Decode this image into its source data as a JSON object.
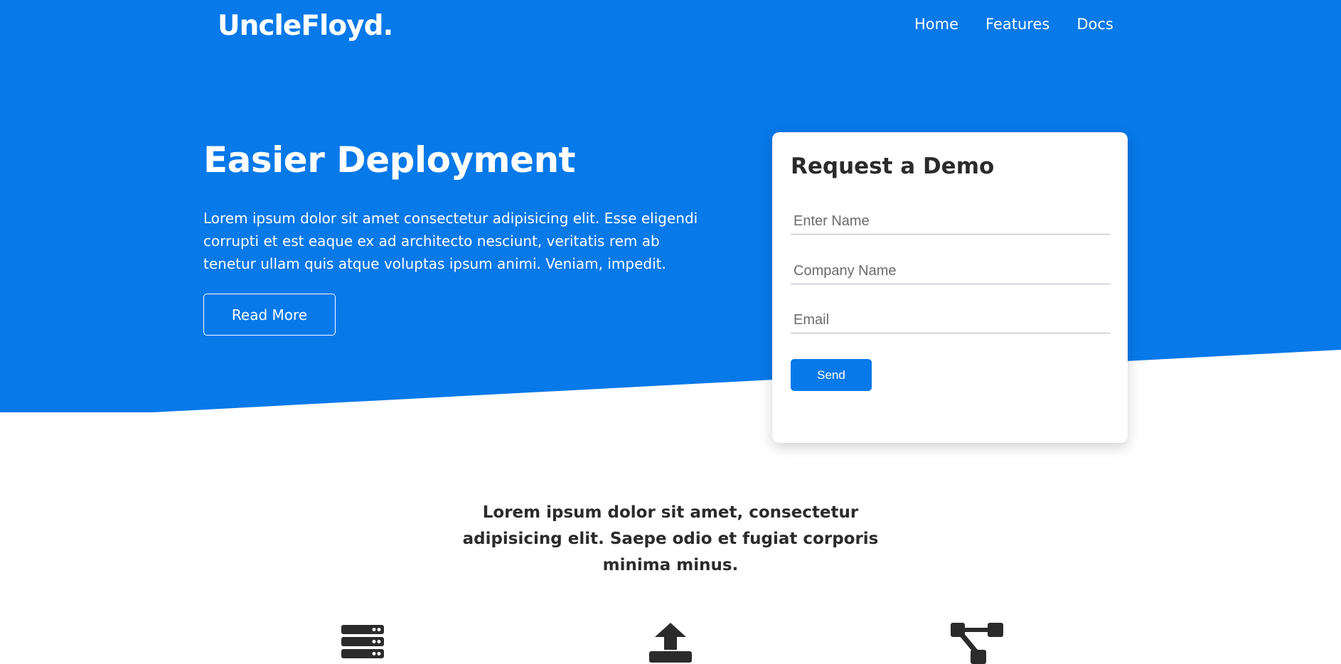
{
  "brand": {
    "logo": "UncleFloyd."
  },
  "nav": {
    "items": [
      {
        "label": "Home"
      },
      {
        "label": "Features"
      },
      {
        "label": "Docs"
      }
    ]
  },
  "hero": {
    "title": "Easier Deployment",
    "text": "Lorem ipsum dolor sit amet consectetur adipisicing elit. Esse eligendi corrupti et est eaque ex ad architecto nesciunt, veritatis rem ab tenetur ullam quis atque voluptas ipsum animi. Veniam, impedit.",
    "button_label": "Read More"
  },
  "demo_form": {
    "title": "Request a Demo",
    "name_placeholder": "Enter Name",
    "company_placeholder": "Company Name",
    "email_placeholder": "Email",
    "send_label": "Send"
  },
  "features": {
    "intro": "Lorem ipsum dolor sit amet, consectetur adipisicing elit. Saepe odio et fugiat corporis minima minus.",
    "icons": [
      "server-icon",
      "upload-icon",
      "network-icon"
    ]
  },
  "colors": {
    "primary": "#0779e9",
    "text_dark": "#2b2b2b",
    "white": "#ffffff"
  }
}
